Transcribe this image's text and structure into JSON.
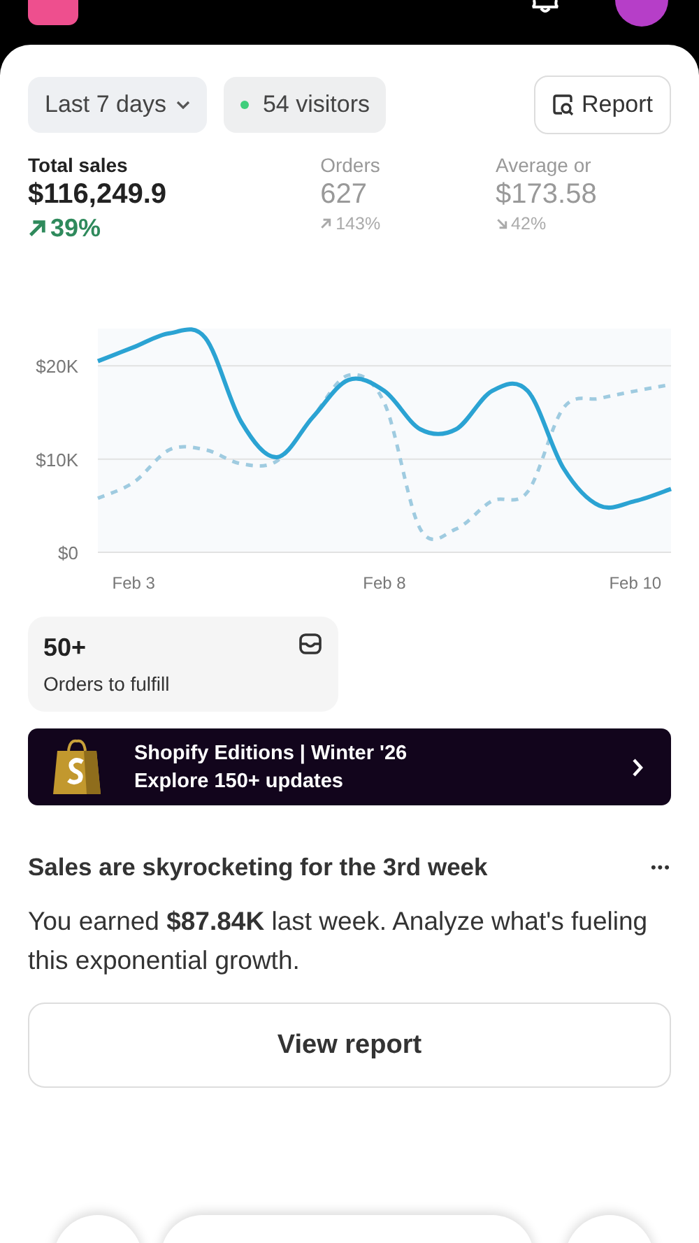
{
  "filters": {
    "date_range": "Last 7 days",
    "visitors": "54 visitors",
    "report_button": "Report"
  },
  "metrics": [
    {
      "label": "Total sales",
      "value": "$116,249.9",
      "change": "39%",
      "kind": "up",
      "selected": true
    },
    {
      "label": "Orders",
      "value": "627",
      "change": "143%",
      "kind": "up",
      "selected": false
    },
    {
      "label": "Average or",
      "value": "$173.58",
      "change": "42%",
      "kind": "down",
      "selected": false
    }
  ],
  "chart_data": {
    "type": "line",
    "categories": [
      null,
      "Feb 3",
      null,
      null,
      null,
      null,
      null,
      null,
      "Feb 8",
      null,
      null,
      null,
      null,
      null,
      null,
      "Feb 10",
      null
    ],
    "ylim": [
      0,
      24000
    ],
    "yticks": [
      {
        "value": 0,
        "label": "$0"
      },
      {
        "value": 10000,
        "label": "$10K"
      },
      {
        "value": 20000,
        "label": "$20K"
      }
    ],
    "series": [
      {
        "color": "#2ba3d3",
        "line_style": "solid",
        "values": [
          20500,
          22000,
          23500,
          23000,
          14000,
          10200,
          14500,
          18500,
          17300,
          13200,
          13200,
          17300,
          17300,
          9000,
          5000,
          5500,
          6800
        ]
      },
      {
        "color": "#9fcbe0",
        "line_style": "dashed",
        "values": [
          5800,
          7500,
          11000,
          11000,
          9500,
          9800,
          14500,
          19000,
          16000,
          2500,
          2500,
          5500,
          6500,
          15500,
          16500,
          17300,
          18000
        ]
      }
    ]
  },
  "fulfill_card": {
    "count": "50+",
    "label": "Orders to fulfill"
  },
  "banner": {
    "title": "Shopify Editions | Winter '26",
    "subtitle": "Explore 150+ updates"
  },
  "insight": {
    "title": "Sales are skyrocketing for the 3rd week",
    "more": "•••",
    "body": "You earned **$87.84K** last week. Analyze what's fueling this exponential growth.",
    "button": "View report"
  }
}
